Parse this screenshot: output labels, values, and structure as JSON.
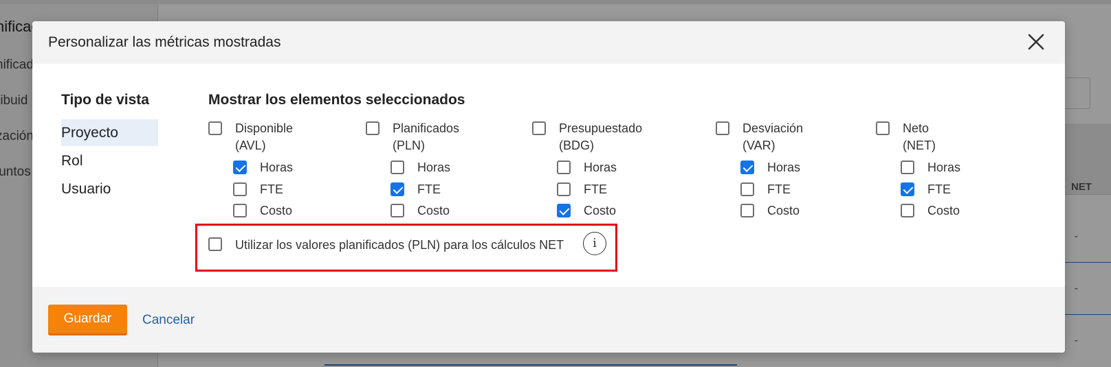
{
  "background": {
    "sidebar_title": "nificac",
    "sidebar_items": [
      "nificad",
      "ribuid",
      "zación",
      "juntos"
    ],
    "net_header": "NET",
    "dashes": [
      "-",
      "-",
      "-"
    ]
  },
  "modal": {
    "title": "Personalizar las métricas mostradas",
    "close_icon": "close-icon",
    "view_type": {
      "heading": "Tipo de vista",
      "items": [
        {
          "label": "Proyecto",
          "active": true
        },
        {
          "label": "Rol",
          "active": false
        },
        {
          "label": "Usuario",
          "active": false
        }
      ]
    },
    "metrics": {
      "heading": "Mostrar los elementos seleccionados",
      "groups": [
        {
          "line1": "Disponible",
          "line2": "(AVL)",
          "checked": false,
          "options": [
            {
              "label": "Horas",
              "checked": true
            },
            {
              "label": "FTE",
              "checked": false
            },
            {
              "label": "Costo",
              "checked": false
            }
          ]
        },
        {
          "line1": "Planificados",
          "line2": "(PLN)",
          "checked": false,
          "options": [
            {
              "label": "Horas",
              "checked": false
            },
            {
              "label": "FTE",
              "checked": true
            },
            {
              "label": "Costo",
              "checked": false
            }
          ]
        },
        {
          "line1": "Presupuestado",
          "line2": "(BDG)",
          "checked": false,
          "options": [
            {
              "label": "Horas",
              "checked": false
            },
            {
              "label": "FTE",
              "checked": false
            },
            {
              "label": "Costo",
              "checked": true
            }
          ]
        },
        {
          "line1": "Desviación",
          "line2": "(VAR)",
          "checked": false,
          "options": [
            {
              "label": "Horas",
              "checked": true
            },
            {
              "label": "FTE",
              "checked": false
            },
            {
              "label": "Costo",
              "checked": false
            }
          ]
        },
        {
          "line1": "Neto",
          "line2": "(NET)",
          "checked": false,
          "options": [
            {
              "label": "Horas",
              "checked": false
            },
            {
              "label": "FTE",
              "checked": true
            },
            {
              "label": "Costo",
              "checked": false
            }
          ]
        }
      ],
      "pln_option": {
        "label": "Utilizar los valores planificados (PLN) para los cálculos NET",
        "checked": false,
        "info_icon": "info-icon"
      }
    },
    "footer": {
      "save_label": "Guardar",
      "cancel_label": "Cancelar"
    }
  },
  "colors": {
    "accent": "#1473e6",
    "save_button": "#f5820b",
    "highlight": "#e3001b",
    "link": "#2a5da8"
  }
}
